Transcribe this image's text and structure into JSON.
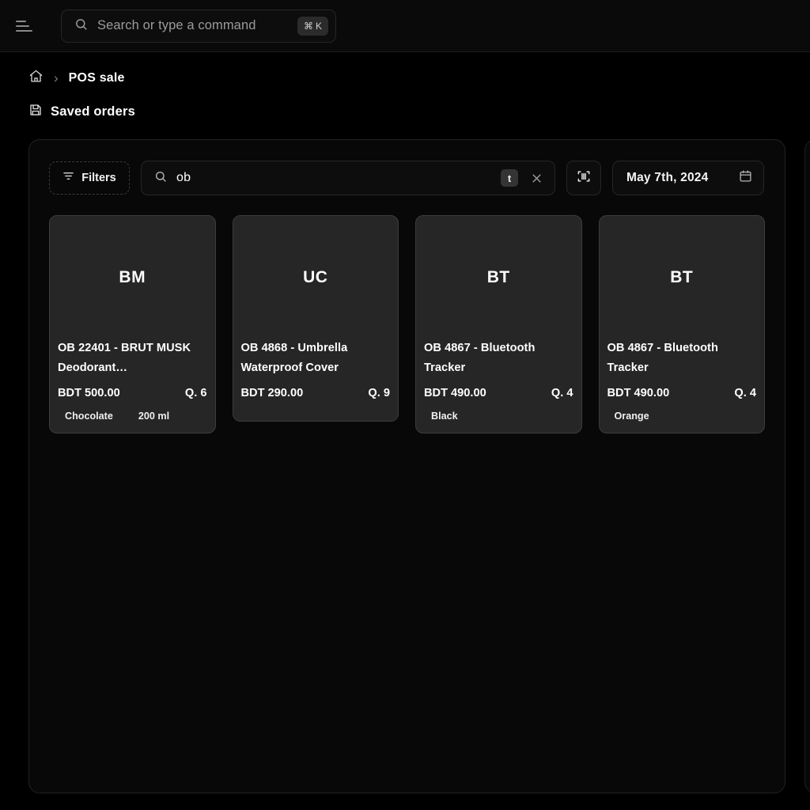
{
  "topbar": {
    "menu_icon": "hamburger-icon",
    "search": {
      "icon": "search-icon",
      "placeholder": "Search or type a command",
      "shortcut_symbol": "⌘",
      "shortcut_key": "K"
    }
  },
  "breadcrumb": {
    "home_icon": "home-icon",
    "separator": "›",
    "current": "POS sale"
  },
  "section": {
    "icon": "save-icon",
    "title": "Saved orders"
  },
  "toolbar": {
    "filters_label": "Filters",
    "filters_icon": "filter-icon",
    "search_icon": "search-icon",
    "search_value": "ob",
    "search_shortcut_badge": "t",
    "clear_icon": "close-icon",
    "scan_icon": "barcode-scanner-icon",
    "date_value": "May 7th, 2024",
    "calendar_icon": "calendar-icon"
  },
  "products": [
    {
      "initials": "BM",
      "name": "OB 22401 - BRUT MUSK Deodorant…",
      "price": "BDT 500.00",
      "qty": "Q. 6",
      "variants": [
        "Chocolate",
        "200 ml"
      ]
    },
    {
      "initials": "UC",
      "name": "OB 4868 - Umbrella Waterproof Cover",
      "price": "BDT 290.00",
      "qty": "Q. 9",
      "variants": []
    },
    {
      "initials": "BT",
      "name": "OB 4867 - Bluetooth Tracker",
      "price": "BDT 490.00",
      "qty": "Q. 4",
      "variants": [
        "Black"
      ]
    },
    {
      "initials": "BT",
      "name": "OB 4867 - Bluetooth Tracker",
      "price": "BDT 490.00",
      "qty": "Q. 4",
      "variants": [
        "Orange"
      ]
    }
  ],
  "colors": {
    "page_bg": "#000000",
    "panel_bg": "#080808",
    "card_bg": "#262626",
    "text": "#ffffff",
    "muted": "#9b9b9b"
  }
}
